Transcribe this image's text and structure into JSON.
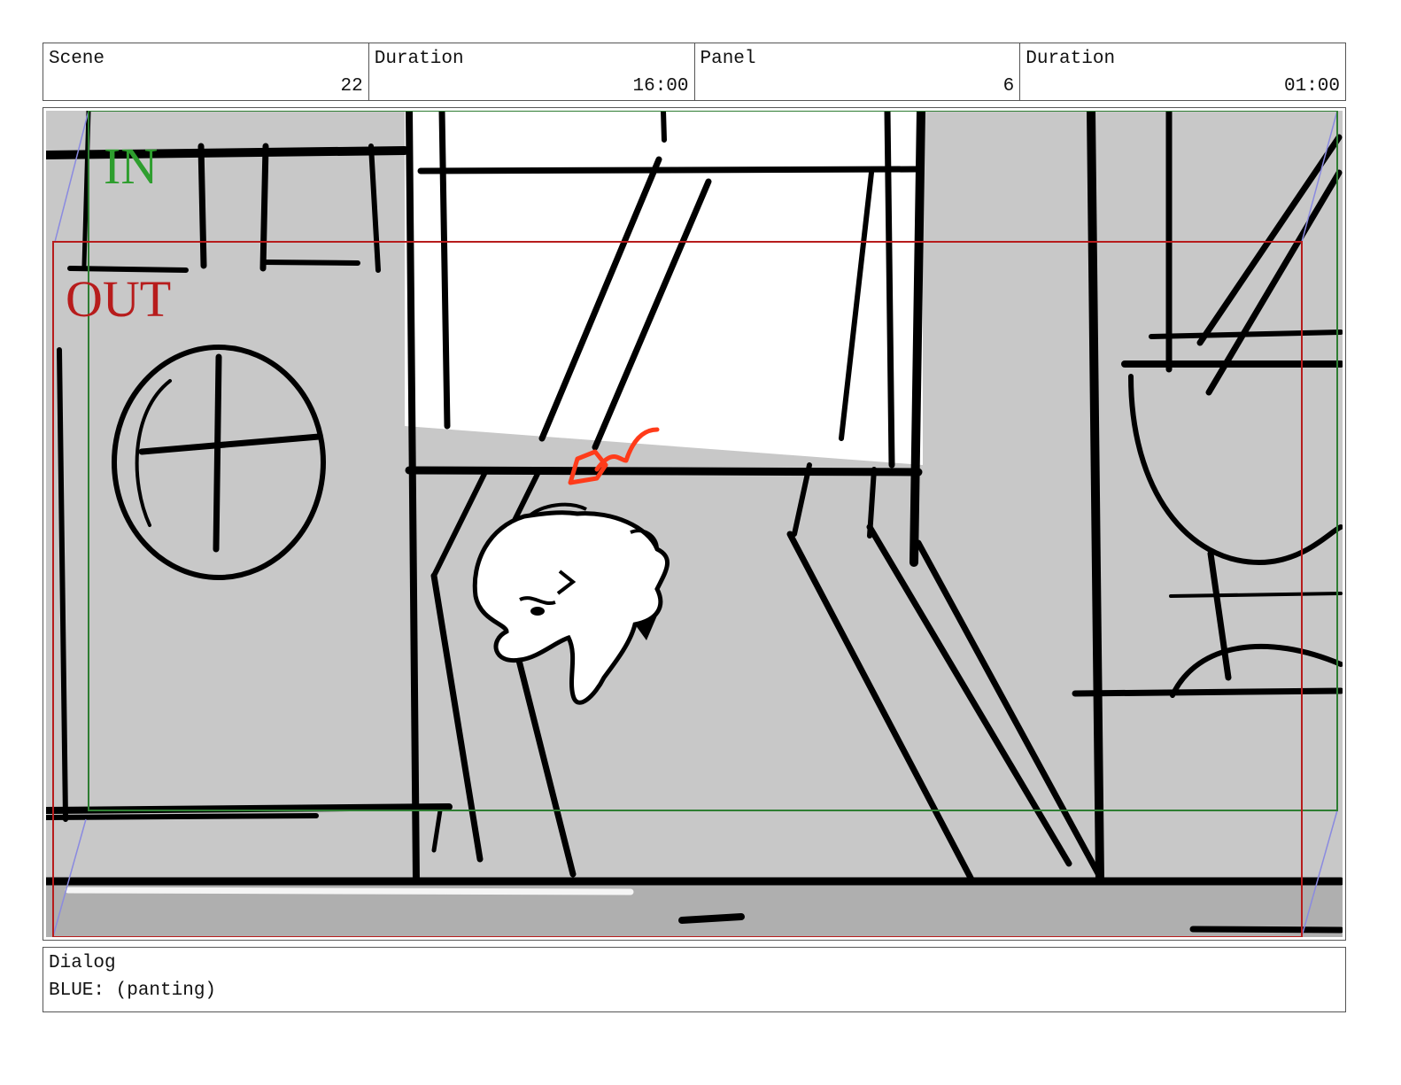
{
  "header": {
    "scene": {
      "label": "Scene",
      "value": "22"
    },
    "scene_duration": {
      "label": "Duration",
      "value": "16:00"
    },
    "panel": {
      "label": "Panel",
      "value": "6"
    },
    "panel_duration": {
      "label": "Duration",
      "value": "01:00"
    }
  },
  "panel_image": {
    "in_label": "IN",
    "out_label": "OUT",
    "colors": {
      "in_frame": "#2e7d32",
      "out_frame": "#b71c1c",
      "background": "#c8c8c8",
      "floor": "#afafaf",
      "ink": "#000000",
      "accent": "#ff3b1a",
      "camera_guide": "#8a8ae0"
    }
  },
  "dialog": {
    "label": "Dialog",
    "text": "BLUE: (panting)"
  }
}
